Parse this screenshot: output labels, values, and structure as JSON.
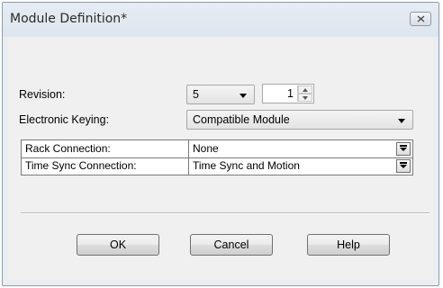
{
  "window": {
    "title": "Module Definition*"
  },
  "revision": {
    "label": "Revision:",
    "major": "5",
    "minor": "1"
  },
  "keying": {
    "label": "Electronic Keying:",
    "value": "Compatible Module"
  },
  "connections": [
    {
      "label": "Rack Connection:",
      "value": "None"
    },
    {
      "label": "Time Sync Connection:",
      "value": "Time Sync and Motion"
    }
  ],
  "buttons": {
    "ok": "OK",
    "cancel": "Cancel",
    "help": "Help"
  },
  "icons": {
    "close": "close-icon",
    "spin_up": "spin-up-icon",
    "spin_down": "spin-down-icon",
    "dropdown": "chevron-down-icon"
  }
}
